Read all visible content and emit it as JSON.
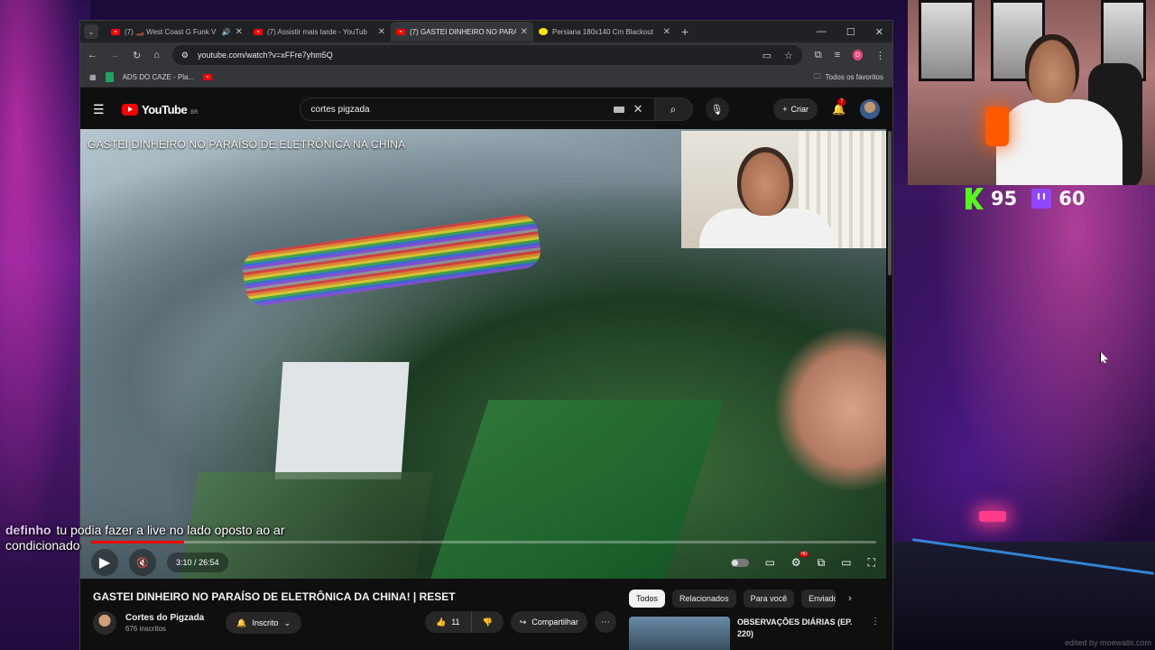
{
  "browser": {
    "tabs": [
      {
        "label": "(7) 🏎️ West Coast G Funk V",
        "icon": "youtube-favicon-icon",
        "active": false,
        "audio": true
      },
      {
        "label": "(7) Assistir mais tarde - YouTub",
        "icon": "youtube-favicon-icon",
        "active": false,
        "audio": false
      },
      {
        "label": "(7) GASTEI DINHEIRO NO PARA",
        "icon": "youtube-favicon-icon",
        "active": true,
        "audio": false
      },
      {
        "label": "Persiana 180x140 Cm Blackout",
        "icon": "mercadolivre-favicon-icon",
        "active": false,
        "audio": false
      }
    ],
    "url": "youtube.com/watch?v=xFFre7yhm5Q",
    "profile_initial": "D",
    "bookmarks": [
      {
        "label": "ADS DO CAZE - Pla...",
        "icon": "sheets-icon"
      }
    ],
    "all_bookmarks_label": "Todos os favoritos"
  },
  "youtube": {
    "logo_text": "YouTube",
    "logo_region": "BR",
    "search_value": "cortes pigzada",
    "create_label": "Criar",
    "notification_count": "7",
    "video": {
      "overlay_title": "GASTEI DINHEIRO NO PARAÍSO DE ELETRÔNICA NA CHINA",
      "current_time": "3:10",
      "duration": "26:54",
      "progress_fraction": 0.118
    },
    "title": "GASTEI DINHEIRO NO PARAÍSO DE ELETRÔNICA DA CHINA! | RESET",
    "channel": {
      "name": "Cortes do Pigzada",
      "subscribers": "676 inscritos",
      "subscribe_label": "Inscrito"
    },
    "likes": "11",
    "share_label": "Compartilhar",
    "chips": [
      "Todos",
      "Relacionados",
      "Para você",
      "Enviado"
    ],
    "recommendation": {
      "title": "OBSERVAÇÕES DIÁRIAS (EP. 220)"
    }
  },
  "stream": {
    "kick_viewers": "95",
    "twitch_viewers": "60",
    "chat": {
      "user": "definho",
      "message": "tu podia fazer a live no lado oposto ao ar condicionado"
    },
    "watermark": "edited by moewalls.com"
  },
  "colors": {
    "youtube_red": "#ff0000",
    "kick_green": "#53fc18",
    "twitch_purple": "#9146ff"
  }
}
